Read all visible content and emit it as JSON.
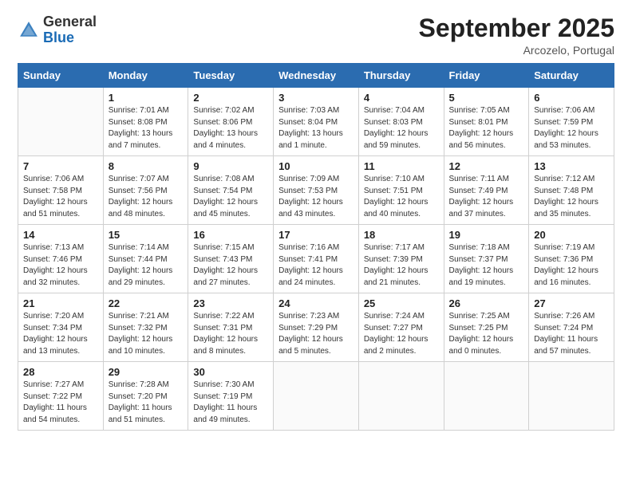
{
  "header": {
    "logo_general": "General",
    "logo_blue": "Blue",
    "title": "September 2025",
    "subtitle": "Arcozelo, Portugal"
  },
  "columns": [
    "Sunday",
    "Monday",
    "Tuesday",
    "Wednesday",
    "Thursday",
    "Friday",
    "Saturday"
  ],
  "weeks": [
    [
      {
        "day": "",
        "sunrise": "",
        "sunset": "",
        "daylight": ""
      },
      {
        "day": "1",
        "sunrise": "Sunrise: 7:01 AM",
        "sunset": "Sunset: 8:08 PM",
        "daylight": "Daylight: 13 hours and 7 minutes."
      },
      {
        "day": "2",
        "sunrise": "Sunrise: 7:02 AM",
        "sunset": "Sunset: 8:06 PM",
        "daylight": "Daylight: 13 hours and 4 minutes."
      },
      {
        "day": "3",
        "sunrise": "Sunrise: 7:03 AM",
        "sunset": "Sunset: 8:04 PM",
        "daylight": "Daylight: 13 hours and 1 minute."
      },
      {
        "day": "4",
        "sunrise": "Sunrise: 7:04 AM",
        "sunset": "Sunset: 8:03 PM",
        "daylight": "Daylight: 12 hours and 59 minutes."
      },
      {
        "day": "5",
        "sunrise": "Sunrise: 7:05 AM",
        "sunset": "Sunset: 8:01 PM",
        "daylight": "Daylight: 12 hours and 56 minutes."
      },
      {
        "day": "6",
        "sunrise": "Sunrise: 7:06 AM",
        "sunset": "Sunset: 7:59 PM",
        "daylight": "Daylight: 12 hours and 53 minutes."
      }
    ],
    [
      {
        "day": "7",
        "sunrise": "Sunrise: 7:06 AM",
        "sunset": "Sunset: 7:58 PM",
        "daylight": "Daylight: 12 hours and 51 minutes."
      },
      {
        "day": "8",
        "sunrise": "Sunrise: 7:07 AM",
        "sunset": "Sunset: 7:56 PM",
        "daylight": "Daylight: 12 hours and 48 minutes."
      },
      {
        "day": "9",
        "sunrise": "Sunrise: 7:08 AM",
        "sunset": "Sunset: 7:54 PM",
        "daylight": "Daylight: 12 hours and 45 minutes."
      },
      {
        "day": "10",
        "sunrise": "Sunrise: 7:09 AM",
        "sunset": "Sunset: 7:53 PM",
        "daylight": "Daylight: 12 hours and 43 minutes."
      },
      {
        "day": "11",
        "sunrise": "Sunrise: 7:10 AM",
        "sunset": "Sunset: 7:51 PM",
        "daylight": "Daylight: 12 hours and 40 minutes."
      },
      {
        "day": "12",
        "sunrise": "Sunrise: 7:11 AM",
        "sunset": "Sunset: 7:49 PM",
        "daylight": "Daylight: 12 hours and 37 minutes."
      },
      {
        "day": "13",
        "sunrise": "Sunrise: 7:12 AM",
        "sunset": "Sunset: 7:48 PM",
        "daylight": "Daylight: 12 hours and 35 minutes."
      }
    ],
    [
      {
        "day": "14",
        "sunrise": "Sunrise: 7:13 AM",
        "sunset": "Sunset: 7:46 PM",
        "daylight": "Daylight: 12 hours and 32 minutes."
      },
      {
        "day": "15",
        "sunrise": "Sunrise: 7:14 AM",
        "sunset": "Sunset: 7:44 PM",
        "daylight": "Daylight: 12 hours and 29 minutes."
      },
      {
        "day": "16",
        "sunrise": "Sunrise: 7:15 AM",
        "sunset": "Sunset: 7:43 PM",
        "daylight": "Daylight: 12 hours and 27 minutes."
      },
      {
        "day": "17",
        "sunrise": "Sunrise: 7:16 AM",
        "sunset": "Sunset: 7:41 PM",
        "daylight": "Daylight: 12 hours and 24 minutes."
      },
      {
        "day": "18",
        "sunrise": "Sunrise: 7:17 AM",
        "sunset": "Sunset: 7:39 PM",
        "daylight": "Daylight: 12 hours and 21 minutes."
      },
      {
        "day": "19",
        "sunrise": "Sunrise: 7:18 AM",
        "sunset": "Sunset: 7:37 PM",
        "daylight": "Daylight: 12 hours and 19 minutes."
      },
      {
        "day": "20",
        "sunrise": "Sunrise: 7:19 AM",
        "sunset": "Sunset: 7:36 PM",
        "daylight": "Daylight: 12 hours and 16 minutes."
      }
    ],
    [
      {
        "day": "21",
        "sunrise": "Sunrise: 7:20 AM",
        "sunset": "Sunset: 7:34 PM",
        "daylight": "Daylight: 12 hours and 13 minutes."
      },
      {
        "day": "22",
        "sunrise": "Sunrise: 7:21 AM",
        "sunset": "Sunset: 7:32 PM",
        "daylight": "Daylight: 12 hours and 10 minutes."
      },
      {
        "day": "23",
        "sunrise": "Sunrise: 7:22 AM",
        "sunset": "Sunset: 7:31 PM",
        "daylight": "Daylight: 12 hours and 8 minutes."
      },
      {
        "day": "24",
        "sunrise": "Sunrise: 7:23 AM",
        "sunset": "Sunset: 7:29 PM",
        "daylight": "Daylight: 12 hours and 5 minutes."
      },
      {
        "day": "25",
        "sunrise": "Sunrise: 7:24 AM",
        "sunset": "Sunset: 7:27 PM",
        "daylight": "Daylight: 12 hours and 2 minutes."
      },
      {
        "day": "26",
        "sunrise": "Sunrise: 7:25 AM",
        "sunset": "Sunset: 7:25 PM",
        "daylight": "Daylight: 12 hours and 0 minutes."
      },
      {
        "day": "27",
        "sunrise": "Sunrise: 7:26 AM",
        "sunset": "Sunset: 7:24 PM",
        "daylight": "Daylight: 11 hours and 57 minutes."
      }
    ],
    [
      {
        "day": "28",
        "sunrise": "Sunrise: 7:27 AM",
        "sunset": "Sunset: 7:22 PM",
        "daylight": "Daylight: 11 hours and 54 minutes."
      },
      {
        "day": "29",
        "sunrise": "Sunrise: 7:28 AM",
        "sunset": "Sunset: 7:20 PM",
        "daylight": "Daylight: 11 hours and 51 minutes."
      },
      {
        "day": "30",
        "sunrise": "Sunrise: 7:30 AM",
        "sunset": "Sunset: 7:19 PM",
        "daylight": "Daylight: 11 hours and 49 minutes."
      },
      {
        "day": "",
        "sunrise": "",
        "sunset": "",
        "daylight": ""
      },
      {
        "day": "",
        "sunrise": "",
        "sunset": "",
        "daylight": ""
      },
      {
        "day": "",
        "sunrise": "",
        "sunset": "",
        "daylight": ""
      },
      {
        "day": "",
        "sunrise": "",
        "sunset": "",
        "daylight": ""
      }
    ]
  ]
}
